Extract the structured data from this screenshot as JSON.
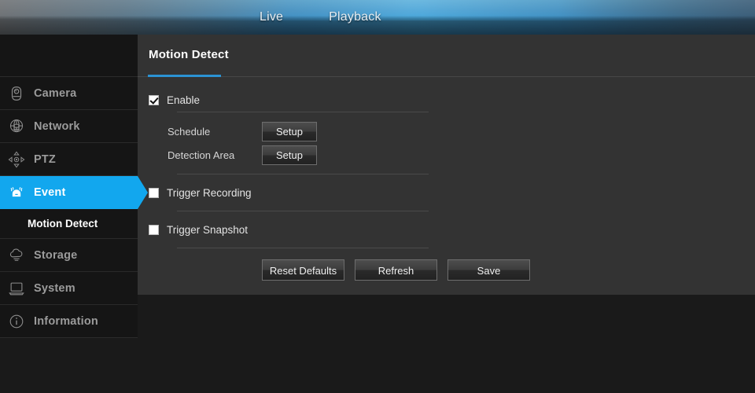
{
  "header": {
    "tabs": [
      {
        "label": "Live",
        "name": "nav-tab-live"
      },
      {
        "label": "Playback",
        "name": "nav-tab-playback"
      }
    ]
  },
  "sidebar": {
    "items": [
      {
        "label": "Camera",
        "icon": "camera-icon",
        "active": false
      },
      {
        "label": "Network",
        "icon": "network-globe-icon",
        "active": false
      },
      {
        "label": "PTZ",
        "icon": "ptz-arrows-icon",
        "active": false
      },
      {
        "label": "Event",
        "icon": "alarm-bell-icon",
        "active": true
      },
      {
        "label": "Storage",
        "icon": "cloud-storage-icon",
        "active": false
      },
      {
        "label": "System",
        "icon": "system-monitor-icon",
        "active": false
      },
      {
        "label": "Information",
        "icon": "info-circle-icon",
        "active": false
      }
    ],
    "submenu": {
      "label": "Motion Detect",
      "parent": "Event"
    }
  },
  "panel": {
    "title": "Motion Detect",
    "enable": {
      "label": "Enable",
      "checked": true
    },
    "fields": [
      {
        "label": "Schedule",
        "button": "Setup"
      },
      {
        "label": "Detection Area",
        "button": "Setup"
      }
    ],
    "triggers": [
      {
        "label": "Trigger Recording",
        "checked": false
      },
      {
        "label": "Trigger Snapshot",
        "checked": false
      }
    ],
    "actions": [
      {
        "label": "Reset Defaults"
      },
      {
        "label": "Refresh"
      },
      {
        "label": "Save"
      }
    ]
  },
  "colors": {
    "accent_blue": "#12a7ee",
    "tab_underline": "#2b93d4",
    "panel_bg": "#333333",
    "sidebar_bg": "#151515",
    "page_bg": "#1a1a1a"
  }
}
